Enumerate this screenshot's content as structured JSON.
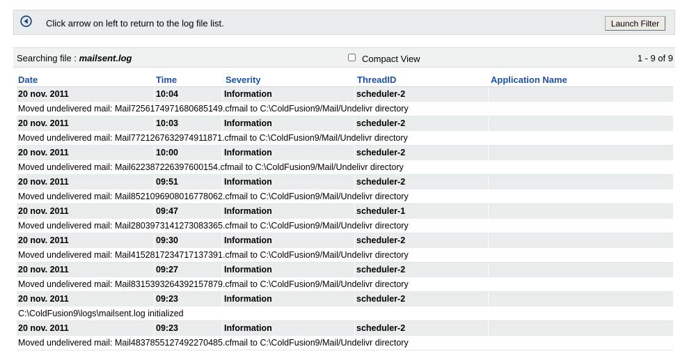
{
  "topbar": {
    "back_icon": "circle-left-arrow-icon",
    "message": "Click arrow on left to return to the log file list.",
    "launch_label": "Launch Filter"
  },
  "search": {
    "label": "Searching file :",
    "file": "mailsent.log",
    "compact_label": "Compact View",
    "compact_checked": false,
    "count": "1 - 9 of 9"
  },
  "columns": [
    "Date",
    "Time",
    "Severity",
    "ThreadID",
    "Application Name"
  ],
  "entries": [
    {
      "date": "20 nov. 2011",
      "time": "10:04",
      "severity": "Information",
      "thread": "scheduler-2",
      "app": "",
      "message": "Moved undelivered mail: Mail7256174971680685149.cfmail to C:\\ColdFusion9/Mail/Undelivr directory"
    },
    {
      "date": "20 nov. 2011",
      "time": "10:03",
      "severity": "Information",
      "thread": "scheduler-2",
      "app": "",
      "message": "Moved undelivered mail: Mail7721267632974911871.cfmail to C:\\ColdFusion9/Mail/Undelivr directory"
    },
    {
      "date": "20 nov. 2011",
      "time": "10:00",
      "severity": "Information",
      "thread": "scheduler-2",
      "app": "",
      "message": "Moved undelivered mail: Mail622387226397600154.cfmail to C:\\ColdFusion9/Mail/Undelivr directory"
    },
    {
      "date": "20 nov. 2011",
      "time": "09:51",
      "severity": "Information",
      "thread": "scheduler-2",
      "app": "",
      "message": "Moved undelivered mail: Mail8521096908016778062.cfmail to C:\\ColdFusion9/Mail/Undelivr directory"
    },
    {
      "date": "20 nov. 2011",
      "time": "09:47",
      "severity": "Information",
      "thread": "scheduler-1",
      "app": "",
      "message": "Moved undelivered mail: Mail2803973141273083365.cfmail to C:\\ColdFusion9/Mail/Undelivr directory"
    },
    {
      "date": "20 nov. 2011",
      "time": "09:30",
      "severity": "Information",
      "thread": "scheduler-2",
      "app": "",
      "message": "Moved undelivered mail: Mail4152817234717137391.cfmail to C:\\ColdFusion9/Mail/Undelivr directory"
    },
    {
      "date": "20 nov. 2011",
      "time": "09:27",
      "severity": "Information",
      "thread": "scheduler-2",
      "app": "",
      "message": "Moved undelivered mail: Mail8315393264392157879.cfmail to C:\\ColdFusion9/Mail/Undelivr directory"
    },
    {
      "date": "20 nov. 2011",
      "time": "09:23",
      "severity": "Information",
      "thread": "scheduler-2",
      "app": "",
      "message": "C:\\ColdFusion9\\logs\\mailsent.log initialized"
    },
    {
      "date": "20 nov. 2011",
      "time": "09:23",
      "severity": "Information",
      "thread": "scheduler-2",
      "app": "",
      "message": "Moved undelivered mail: Mail4837855127492270485.cfmail to C:\\ColdFusion9/Mail/Undelivr directory"
    }
  ],
  "colors": {
    "header_link": "#2050a0",
    "row_band": "#e8ecec",
    "toolbar": "#e8ecec"
  }
}
